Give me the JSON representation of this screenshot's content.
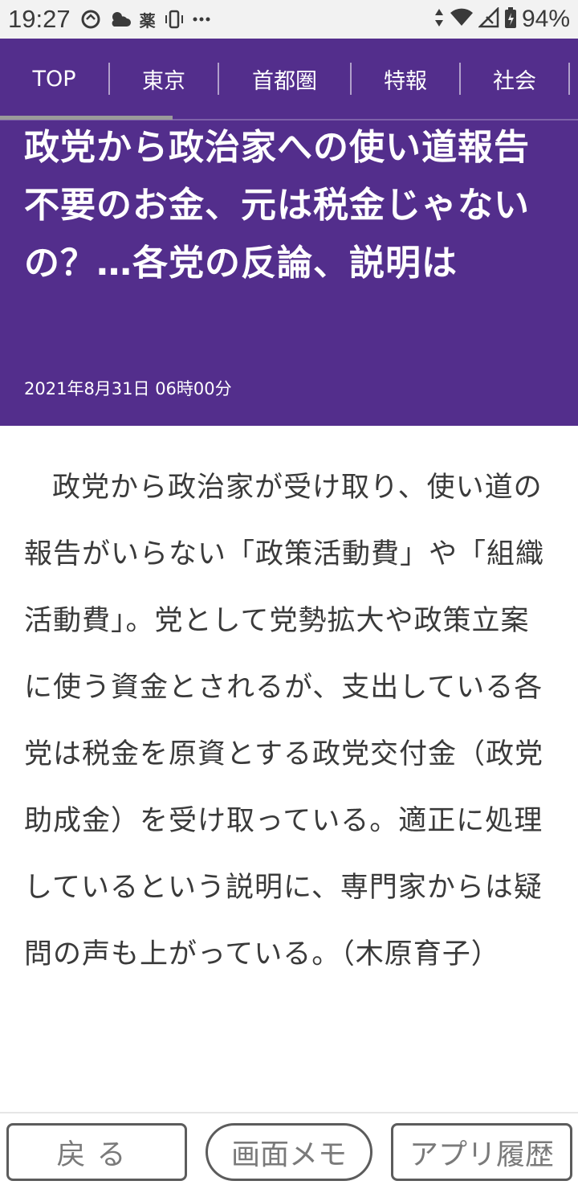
{
  "status_bar": {
    "time": "19:27",
    "battery": "94%",
    "icons_left": [
      "sync-icon",
      "weather-icon",
      "pharmacy-icon",
      "phone-vibrate-icon",
      "more-icon"
    ],
    "icons_right": [
      "data-arrows-icon",
      "wifi-icon",
      "signal-icon",
      "battery-icon"
    ],
    "pharmacy_glyph": "薬"
  },
  "nav": {
    "items": [
      "TOP",
      "東京",
      "首都圏",
      "特報",
      "社会"
    ]
  },
  "article": {
    "headline": "政党から政治家への使い道報告不要のお金、元は税金じゃないの？…各党の反論、説明は",
    "date": "2021年8月31日 06時00分",
    "body": "政党から政治家が受け取り、使い道の報告がいらない「政策活動費」や「組織活動費」。党として党勢拡大や政策立案に使う資金とされるが、支出している各党は税金を原資とする政党交付金（政党助成金）を受け取っている。適正に処理しているという説明に、専門家からは疑問の声も上がっている。（木原育子）"
  },
  "bottom_bar": {
    "back": "戻る",
    "memo": "画面メモ",
    "history": "アプリ履歴"
  },
  "colors": {
    "header_bg": "#532e8c",
    "status_bg": "#f2f2f2",
    "text": "#3a3a3a"
  }
}
